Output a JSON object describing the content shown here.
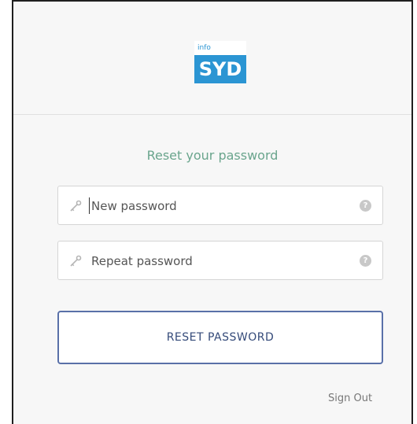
{
  "logo": {
    "small_text": "info",
    "large_text": "SYD",
    "colors": {
      "brand_blue": "#2b95d3"
    }
  },
  "form": {
    "title": "Reset your password",
    "fields": [
      {
        "placeholder": "New password",
        "icon": "key-icon",
        "help_icon": "help-icon"
      },
      {
        "placeholder": "Repeat password",
        "icon": "key-icon",
        "help_icon": "help-icon"
      }
    ],
    "button_label": "RESET PASSWORD",
    "signout_label": "Sign Out",
    "colors": {
      "title": "#6aa58d",
      "button_border": "#5970a8",
      "button_text": "#344a79"
    }
  }
}
